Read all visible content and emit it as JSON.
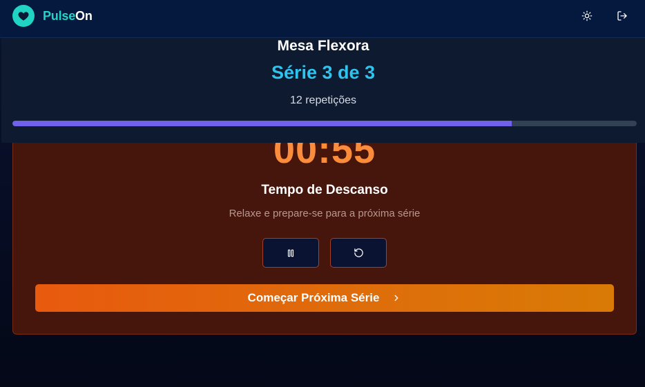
{
  "app": {
    "brand_part1": "Pulse",
    "brand_part2": "On",
    "brand_color": "#22d3c5",
    "logo_icon": "heart-icon"
  },
  "navbar": {
    "theme_icon": "sun-icon",
    "logout_icon": "logout-icon"
  },
  "exercise": {
    "name": "Mesa Flexora",
    "series_label": "Série 3 de 3",
    "reps_label": "12 repetições",
    "progress": 0.8
  },
  "rest": {
    "timer": "00:55",
    "title": "Tempo de Descanso",
    "subtitle": "Relaxe e prepare-se para a próxima série",
    "pause_icon": "pause-icon",
    "reset_icon": "reset-icon",
    "next_label": "Começar Próxima Série",
    "next_icon": "chevron-right-icon"
  },
  "colors": {
    "accent_series": "#2ec4ee",
    "timer": "#fb8c3c",
    "progress": "#7160ea",
    "rest_bg": "#46160c",
    "button_gradient_start": "#e85a0e",
    "button_gradient_end": "#d97a06"
  }
}
